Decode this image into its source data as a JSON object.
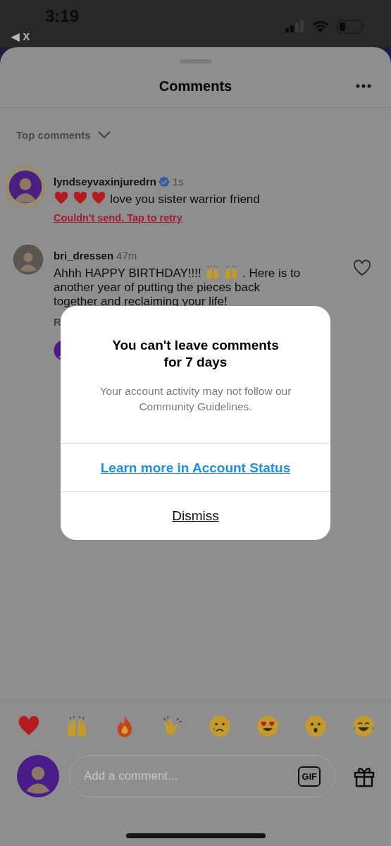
{
  "status_bar": {
    "time": "3:19",
    "back_label": "◀ X"
  },
  "sheet": {
    "title": "Comments",
    "sort_label": "Top comments"
  },
  "comments": [
    {
      "username": "lyndseyvaxinjuredrn",
      "verified": true,
      "time": "1s",
      "has_story": true,
      "body": [
        [
          {
            "kind": "heart-emoji"
          },
          {
            "kind": "heart-emoji"
          },
          {
            "kind": "heart-emoji"
          },
          {
            "kind": "text",
            "text": "love you sister warrior friend"
          }
        ]
      ],
      "error": "Couldn't send. Tap to retry"
    },
    {
      "username": "bri_dressen",
      "verified": false,
      "time": "47m",
      "has_story": false,
      "body": [
        [
          {
            "kind": "text",
            "text": "Ahhh HAPPY BIRTHDAY!!!!"
          },
          {
            "kind": "hands-emoji"
          },
          {
            "kind": "hands-emoji"
          },
          {
            "kind": "text",
            "text": ". Here is to"
          }
        ],
        [
          {
            "kind": "text",
            "text": "another year of putting the pieces back together and reclaiming your life!"
          }
        ]
      ],
      "liked": false,
      "reply_label": "R",
      "reply_avatar": true
    }
  ],
  "reactions": [
    {
      "kind": "heart"
    },
    {
      "kind": "raised-hands"
    },
    {
      "kind": "fire"
    },
    {
      "kind": "clap"
    },
    {
      "kind": "cry"
    },
    {
      "kind": "heart-eyes"
    },
    {
      "kind": "surprised"
    },
    {
      "kind": "laugh"
    }
  ],
  "composer": {
    "placeholder": "Add a comment...",
    "gif_label": "GIF"
  },
  "dialog": {
    "title": "You can't leave comments for 7 days",
    "message": "Your account activity may not follow our Community Guidelines.",
    "actions": [
      {
        "kind": "link",
        "label": "Learn more in Account Status"
      },
      {
        "kind": "plain",
        "label": "Dismiss"
      }
    ]
  }
}
